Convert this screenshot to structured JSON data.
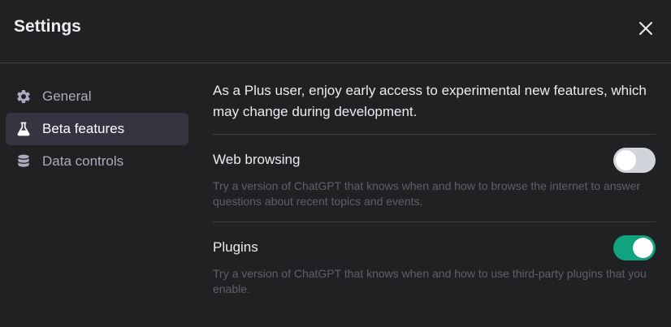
{
  "dialog": {
    "title": "Settings"
  },
  "sidebar": {
    "items": [
      {
        "label": "General",
        "icon": "gear-icon",
        "active": false
      },
      {
        "label": "Beta features",
        "icon": "flask-icon",
        "active": true
      },
      {
        "label": "Data controls",
        "icon": "database-icon",
        "active": false
      }
    ]
  },
  "main": {
    "intro": "As a Plus user, enjoy early access to experimental new features, which may change during development.",
    "features": [
      {
        "name": "Web browsing",
        "description": "Try a version of ChatGPT that knows when and how to browse the internet to answer questions about recent topics and events.",
        "enabled": false
      },
      {
        "name": "Plugins",
        "description": "Try a version of ChatGPT that knows when and how to use third-party plugins that you enable.",
        "enabled": true
      }
    ]
  },
  "colors": {
    "background": "#202123",
    "active_item": "#343541",
    "toggle_on": "#10a37f",
    "toggle_off": "#d1d5db"
  }
}
